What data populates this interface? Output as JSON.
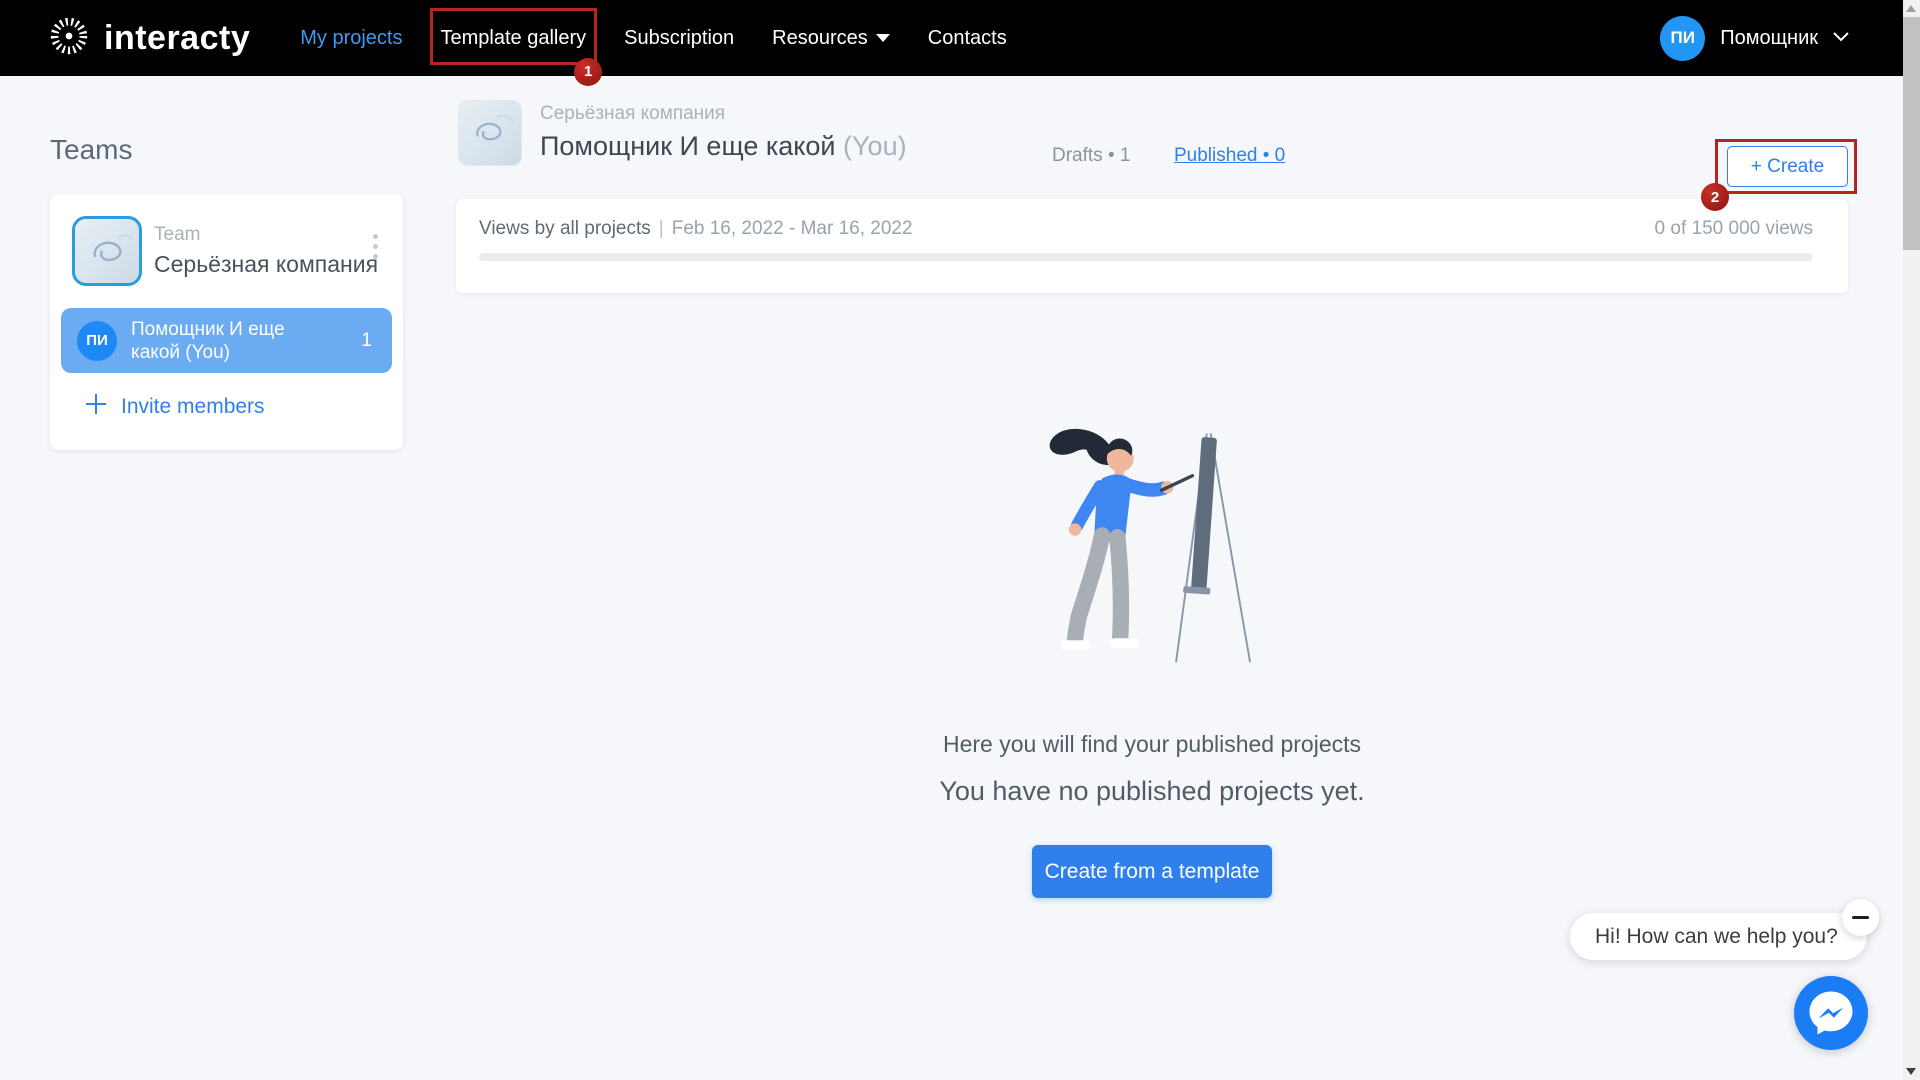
{
  "nav": {
    "brand": "interacty",
    "items": [
      {
        "label": "My projects",
        "active": true
      },
      {
        "label": "Template gallery",
        "highlighted": true
      },
      {
        "label": "Subscription"
      },
      {
        "label": "Resources",
        "has_dropdown": true
      },
      {
        "label": "Contacts"
      }
    ],
    "user": {
      "initials": "ПИ",
      "name": "Помощник"
    }
  },
  "annotations": {
    "step1": "1",
    "step2": "2",
    "highlight_color": "#b3261e"
  },
  "sidebar": {
    "title": "Teams",
    "team": {
      "type_label": "Team",
      "name": "Серьёзная компания"
    },
    "member": {
      "initials": "ПИ",
      "name_line1": "Помощник И еще",
      "name_line2": "какой (You)",
      "count": "1"
    },
    "invite_label": "Invite members"
  },
  "header": {
    "team_name": "Серьёзная компания",
    "member_name": "Помощник И еще какой",
    "member_suffix": "(You)",
    "drafts_text": "Drafts • 1",
    "published_text": "Published  • 0",
    "create_label": "+ Create"
  },
  "views": {
    "label": "Views by all projects",
    "separator": "|",
    "date_range": "Feb 16, 2022 - Mar 16, 2022",
    "usage": "0 of 150 000 views",
    "progress_percent": 0
  },
  "empty_state": {
    "line1": "Here you will find your published projects",
    "line2": "You have no published projects yet.",
    "cta": "Create from a template"
  },
  "chat": {
    "greeting": "Hi! How can we help you?"
  },
  "colors": {
    "accent": "#2f80ed",
    "nav_active_link": "#3d9af0",
    "member_row": "#6aabf2",
    "avatar_blue": "#2196f3",
    "annotation_red": "#b3261e",
    "messenger_blue": "#1a7df5",
    "nav_background": "#000000",
    "page_background": "#f5f7fa"
  }
}
